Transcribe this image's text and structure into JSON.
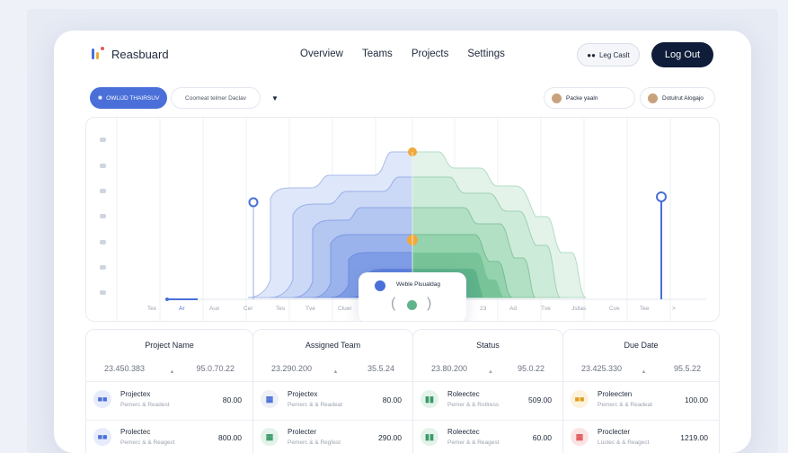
{
  "brand": {
    "name": "Reasbuard"
  },
  "nav": {
    "items": [
      "Overview",
      "Teams",
      "Projects",
      "Settings"
    ],
    "ghost_label": "Leg Caslt",
    "logout_label": "Log Out"
  },
  "filters": {
    "active_chip": "OWLIJD THAIRSUV",
    "dropdown": "Coomeat telmer Daclav",
    "people": [
      "Packe yaaln",
      "Dotulrut Alogajo"
    ]
  },
  "chart": {
    "x_ticks": [
      "Tex",
      "Ar",
      "Aux",
      "Cer",
      "Tes",
      "Tve",
      "Cluer",
      "",
      "",
      "23",
      "Ad",
      "Tve",
      "Jsllas",
      "Cve",
      "Tee",
      ">"
    ],
    "colors": {
      "blue": "#4a6fd8",
      "green": "#5fb48b",
      "highlight": "#f0a93a"
    },
    "tooltip": {
      "title": "Weble Pluualdag"
    }
  },
  "table": {
    "columns": [
      {
        "header": "Project Name",
        "sub_a": "23.450.383",
        "sub_b": "95.0.70.22",
        "rows": [
          {
            "title": "Projectex",
            "sub": "Pemerc & Readest",
            "value": "80.00",
            "icon": "people-icon",
            "color": "#4a6fd8",
            "bg": "#e6ecfb"
          },
          {
            "title": "Prolectec",
            "sub": "Pemerc & & Reagect",
            "value": "800.00",
            "icon": "people-icon",
            "color": "#4a6fd8",
            "bg": "#e6ecfb"
          }
        ]
      },
      {
        "header": "Assigned Team",
        "sub_a": "23.290.200",
        "sub_b": "35.5.24",
        "rows": [
          {
            "title": "Projectex",
            "sub": "Pemerc & & Readeat",
            "value": "80.00",
            "icon": "grid-icon",
            "color": "#4a6fd8",
            "bg": "#eef0f5"
          },
          {
            "title": "Prolecter",
            "sub": "Pemerc & & Regfest",
            "value": "290.00",
            "icon": "grid-icon",
            "color": "#3a9a6a",
            "bg": "#e4f3ea"
          }
        ]
      },
      {
        "header": "Status",
        "sub_a": "23.80.200",
        "sub_b": "95.0.22",
        "rows": [
          {
            "title": "Roleectec",
            "sub": "Pemer & & Rotlress",
            "value": "509.00",
            "icon": "bars-icon",
            "color": "#3a9a6a",
            "bg": "#e4f3ea"
          },
          {
            "title": "Roleectec",
            "sub": "Pemer & & Reagest",
            "value": "60.00",
            "icon": "bars-icon",
            "color": "#3a9a6a",
            "bg": "#e4f3ea"
          }
        ]
      },
      {
        "header": "Due Date",
        "sub_a": "23.425.330",
        "sub_b": "95.5.22",
        "rows": [
          {
            "title": "Proleecten",
            "sub": "Pemerc & & Readeat",
            "value": "100.00",
            "icon": "people-icon",
            "color": "#e0a020",
            "bg": "#fdf2dc"
          },
          {
            "title": "Proclecter",
            "sub": "Lustec & & Reagect",
            "value": "1219.00",
            "icon": "grid-icon",
            "color": "#e05a5a",
            "bg": "#fde4e4"
          }
        ]
      }
    ]
  }
}
